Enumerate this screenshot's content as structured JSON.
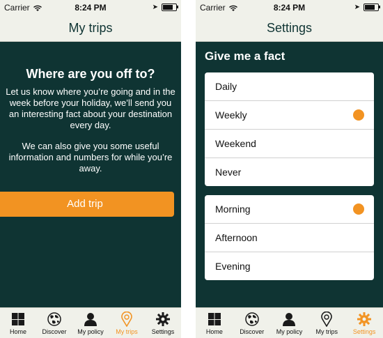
{
  "left": {
    "status": {
      "carrier": "Carrier",
      "time": "8:24 PM"
    },
    "title": "My trips",
    "hero_title": "Where are you off to?",
    "hero_text": "Let us know where you’re going and in the week before your holiday, we’ll send you an interesting fact about your destination every day.",
    "hero_text2": "We can also give you some useful information and numbers for while you’re away.",
    "add_trip_label": "Add trip",
    "tabs": [
      {
        "label": "Home",
        "icon": "home-icon"
      },
      {
        "label": "Discover",
        "icon": "globe-icon"
      },
      {
        "label": "My policy",
        "icon": "person-icon"
      },
      {
        "label": "My trips",
        "icon": "map-pin-icon"
      },
      {
        "label": "Settings",
        "icon": "gear-icon"
      }
    ],
    "active_tab": "My trips"
  },
  "right": {
    "status": {
      "carrier": "Carrier",
      "time": "8:24 PM"
    },
    "title": "Settings",
    "section_title": "Give me a fact",
    "frequency_options": [
      {
        "label": "Daily",
        "selected": false
      },
      {
        "label": "Weekly",
        "selected": true
      },
      {
        "label": "Weekend",
        "selected": false
      },
      {
        "label": "Never",
        "selected": false
      }
    ],
    "time_options": [
      {
        "label": "Morning",
        "selected": true
      },
      {
        "label": "Afternoon",
        "selected": false
      },
      {
        "label": "Evening",
        "selected": false
      }
    ],
    "tabs": [
      {
        "label": "Home",
        "icon": "home-icon"
      },
      {
        "label": "Discover",
        "icon": "globe-icon"
      },
      {
        "label": "My policy",
        "icon": "person-icon"
      },
      {
        "label": "My trips",
        "icon": "map-pin-icon"
      },
      {
        "label": "Settings",
        "icon": "gear-icon"
      }
    ],
    "active_tab": "Settings"
  },
  "colors": {
    "accent": "#f29322",
    "background": "#0f3433",
    "bar": "#f0f1ea"
  }
}
